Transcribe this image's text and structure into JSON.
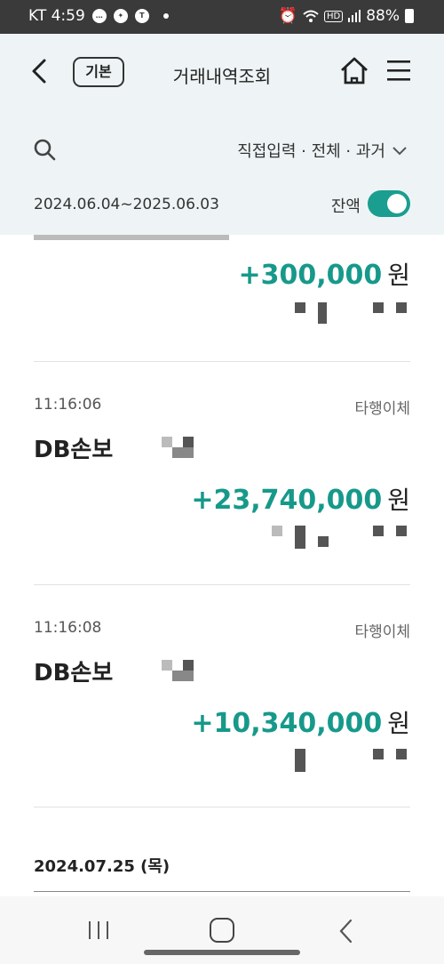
{
  "status_bar": {
    "carrier_time": "KT 4:59",
    "battery": "88%"
  },
  "header": {
    "mode_badge": "기본",
    "title": "거래내역조회",
    "filter": "직접입력 · 전체 · 과거",
    "date_range": "2024.06.04~2025.06.03",
    "balance_label": "잔액",
    "balance_toggle_on": true
  },
  "transactions": [
    {
      "time": "",
      "type": "",
      "name": "",
      "amount": "+300,000",
      "currency": "원"
    },
    {
      "time": "11:16:06",
      "type": "타행이체",
      "name": "DB손보",
      "amount": "+23,740,000",
      "currency": "원"
    },
    {
      "time": "11:16:08",
      "type": "타행이체",
      "name": "DB손보",
      "amount": "+10,340,000",
      "currency": "원"
    }
  ],
  "date_group": "2024.07.25 (목)",
  "colors": {
    "accent": "#16998a",
    "header_bg": "#eef4f5",
    "status_bar_bg": "#3a3a3a"
  }
}
